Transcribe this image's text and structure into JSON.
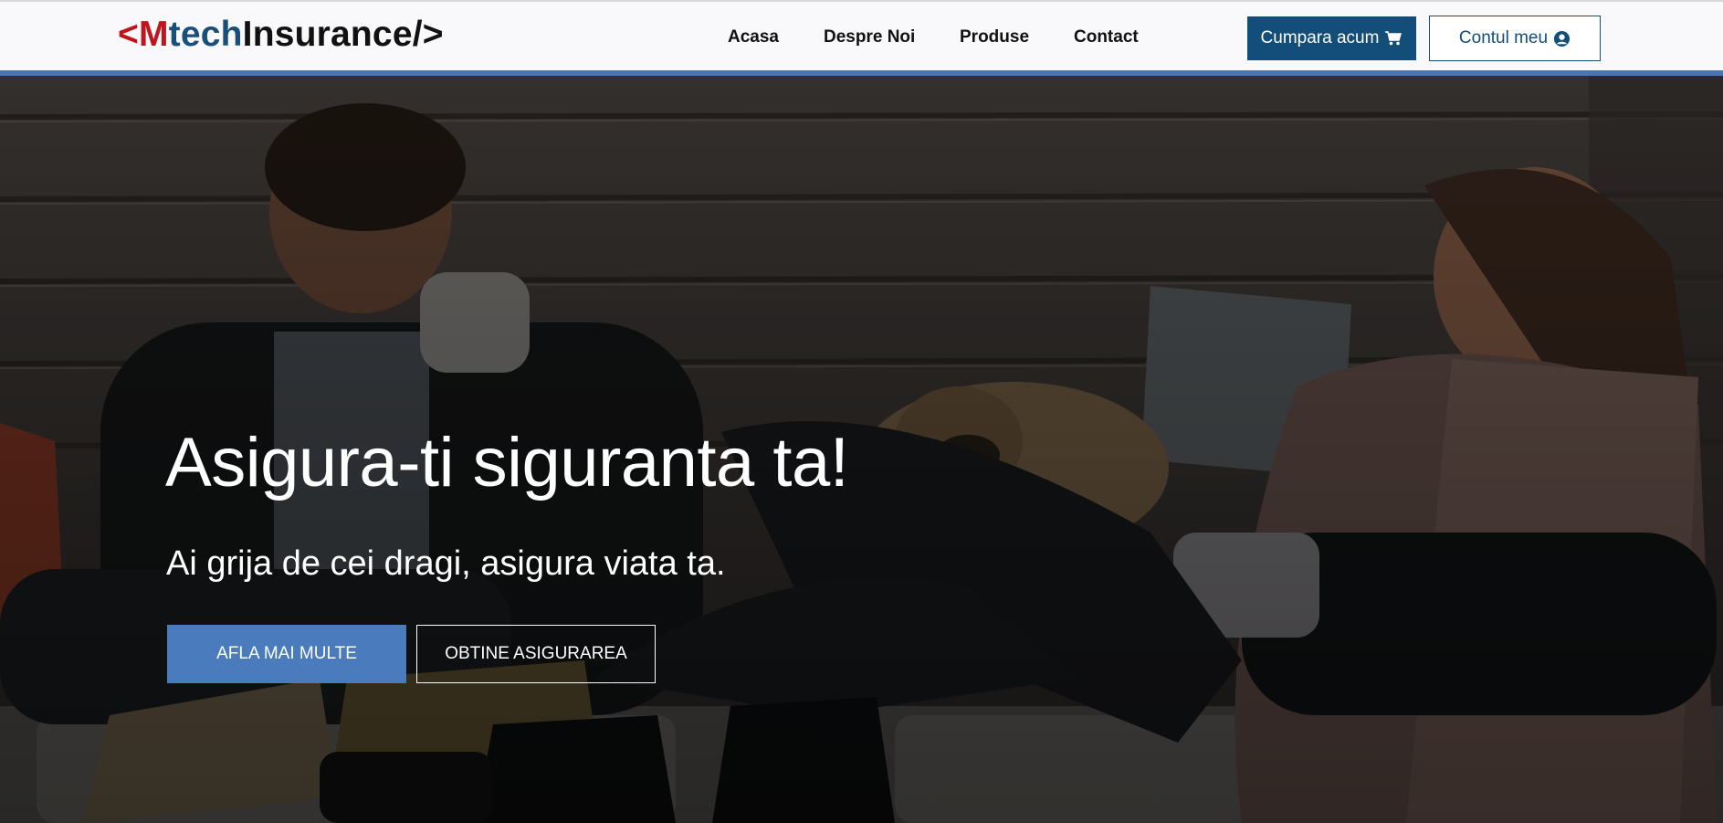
{
  "logo": {
    "open": "<",
    "m": "M",
    "tech": "tech",
    "insurance": "Insurance",
    "close": "/>"
  },
  "nav": [
    {
      "label": "Acasa"
    },
    {
      "label": "Despre Noi"
    },
    {
      "label": "Produse"
    },
    {
      "label": "Contact"
    }
  ],
  "header": {
    "buy_label": "Cumpara acum",
    "buy_icon": "shopping-cart-icon",
    "account_label": "Contul meu",
    "account_icon": "user-circle-icon"
  },
  "hero": {
    "title": "Asigura-ti siguranta ta!",
    "subtitle": "Ai grija de cei dragi, asigura viata ta.",
    "primary_button": "AFLA MAI MULTE",
    "secondary_button": "OBTINE ASIGURAREA"
  },
  "colors": {
    "brand_red": "#c0151d",
    "brand_blue": "#134d7a",
    "accent_blue": "#4a7bbd"
  }
}
